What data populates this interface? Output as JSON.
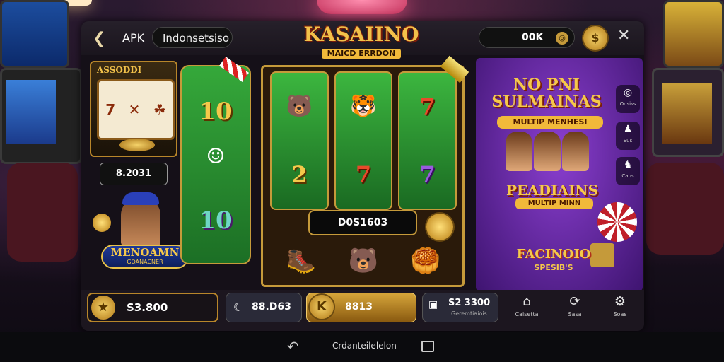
{
  "header": {
    "back_icon": "arrow-left-icon",
    "app_label": "APK",
    "search_value": "Indonsetsiso",
    "logo_title": "KASAIINO",
    "logo_subtitle": "MAICD ERRDON",
    "balance": "00K",
    "balance_icon": "coin-icon",
    "coin_button_icon": "coin-stack-icon",
    "close_icon": "close-icon"
  },
  "left_panel": {
    "mini_title": "ASSODDI",
    "mini_amount": "8.2031",
    "promo_title": "MENOAMN",
    "promo_subtitle": "GOANACNER"
  },
  "reel_left": {
    "symbols": [
      "10",
      "☺",
      "10"
    ]
  },
  "machine": {
    "columns": [
      [
        "🐻",
        "2",
        "🥾"
      ],
      [
        "🐯",
        "7",
        "🐻"
      ],
      [
        "7",
        "7",
        "🥮"
      ]
    ],
    "win_value": "D0S1603"
  },
  "ad_panel": {
    "headline": "NO PNI SULMAINAS",
    "headline_sub": "MULTIP MENHESI",
    "mid_title": "PEADIAINS",
    "mid_sub": "MULTIP MINN",
    "bottom_title": "FACINOIO",
    "bottom_sub": "SPESIB'S",
    "side_buttons": [
      {
        "icon": "ring-icon",
        "label": "Onsiss"
      },
      {
        "icon": "user-icon",
        "label": "Eus"
      },
      {
        "icon": "user-add-icon",
        "label": "Caus"
      }
    ]
  },
  "bottom_bar": {
    "wallet_icon": "star-coin-icon",
    "wallet_value": "S3.800",
    "chat_icon": "chat-icon",
    "chat_value": "88.D63",
    "bet_icon": "k-coin-icon",
    "bet_value": "8813",
    "cards_icon": "cards-icon",
    "cards_value": "S2 3300",
    "cards_sub": "Geremtiaiois",
    "nav": [
      {
        "icon": "shop-icon",
        "label": "Caisetta"
      },
      {
        "icon": "refresh-icon",
        "label": "Sasa"
      },
      {
        "icon": "settings-icon",
        "label": "Soas"
      }
    ]
  },
  "system_nav": {
    "back_icon": "system-back-icon",
    "label": "Crdanteilelelon",
    "recents_icon": "recents-icon"
  }
}
